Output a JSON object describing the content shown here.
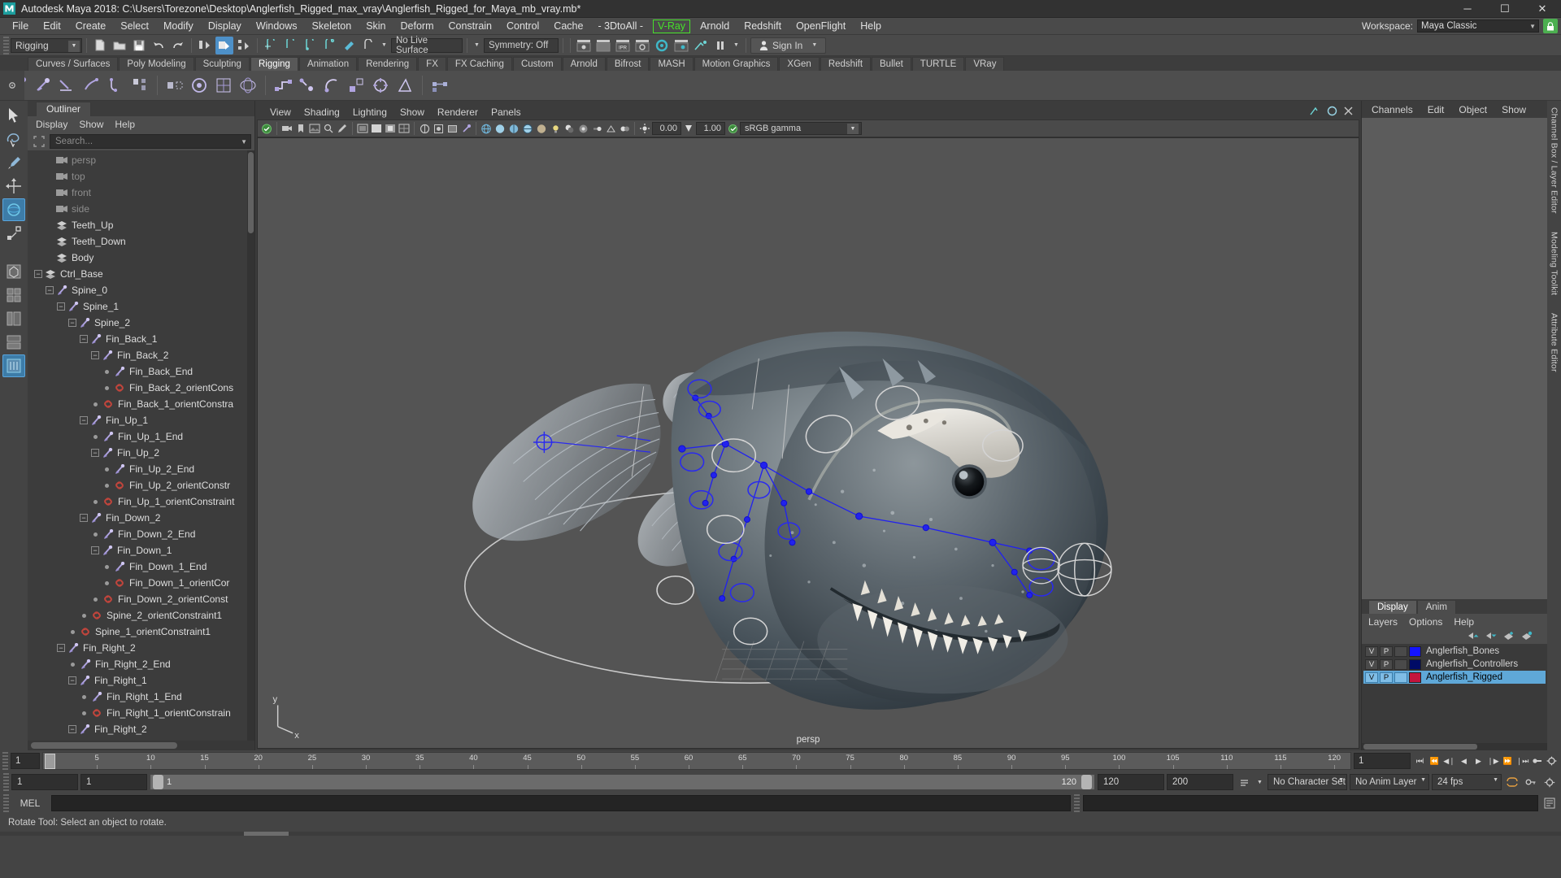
{
  "window": {
    "title": "Autodesk Maya 2018: C:\\Users\\Torezone\\Desktop\\Anglerfish_Rigged_max_vray\\Anglerfish_Rigged_for_Maya_mb_vray.mb*",
    "minimize": "─",
    "maximize": "☐",
    "close": "✕"
  },
  "menubar": {
    "items": [
      "File",
      "Edit",
      "Create",
      "Select",
      "Modify",
      "Display",
      "Windows",
      "Skeleton",
      "Skin",
      "Deform",
      "Constrain",
      "Control",
      "Cache",
      "- 3DtoAll -"
    ],
    "highlighted": "V-Ray",
    "items_after": [
      "Arnold",
      "Redshift",
      "OpenFlight",
      "Help"
    ],
    "workspace_label": "Workspace:",
    "workspace_value": "Maya Classic",
    "lock_icon": "lock-icon"
  },
  "statusbar": {
    "mode": "Rigging",
    "live_surface": "No Live Surface",
    "symmetry": "Symmetry: Off",
    "sign_in": "Sign In"
  },
  "shelf": {
    "tabs": [
      "Curves / Surfaces",
      "Poly Modeling",
      "Sculpting",
      "Rigging",
      "Animation",
      "Rendering",
      "FX",
      "FX Caching",
      "Custom",
      "Arnold",
      "Bifrost",
      "MASH",
      "Motion Graphics",
      "XGen",
      "Redshift",
      "Bullet",
      "TURTLE",
      "VRay"
    ],
    "active_tab": "Rigging"
  },
  "outliner": {
    "tab": "Outliner",
    "menu": [
      "Display",
      "Show",
      "Help"
    ],
    "search_placeholder": "Search...",
    "tree": [
      {
        "label": "persp",
        "depth": 1,
        "icon": "camera-icon",
        "marker": "none",
        "dim": true
      },
      {
        "label": "top",
        "depth": 1,
        "icon": "camera-icon",
        "marker": "none",
        "dim": true
      },
      {
        "label": "front",
        "depth": 1,
        "icon": "camera-icon",
        "marker": "none",
        "dim": true
      },
      {
        "label": "side",
        "depth": 1,
        "icon": "camera-icon",
        "marker": "none",
        "dim": true
      },
      {
        "label": "Teeth_Up",
        "depth": 1,
        "icon": "mesh-icon",
        "marker": "none",
        "dim": false
      },
      {
        "label": "Teeth_Down",
        "depth": 1,
        "icon": "mesh-icon",
        "marker": "none",
        "dim": false
      },
      {
        "label": "Body",
        "depth": 1,
        "icon": "mesh-icon",
        "marker": "none",
        "dim": false
      },
      {
        "label": "Ctrl_Base",
        "depth": 0,
        "icon": "mesh-icon",
        "marker": "expand",
        "dim": false
      },
      {
        "label": "Spine_0",
        "depth": 1,
        "icon": "joint-icon",
        "marker": "expand",
        "dim": false
      },
      {
        "label": "Spine_1",
        "depth": 2,
        "icon": "joint-icon",
        "marker": "expand",
        "dim": false
      },
      {
        "label": "Spine_2",
        "depth": 3,
        "icon": "joint-icon",
        "marker": "expand",
        "dim": false
      },
      {
        "label": "Fin_Back_1",
        "depth": 4,
        "icon": "joint-icon",
        "marker": "expand",
        "dim": false
      },
      {
        "label": "Fin_Back_2",
        "depth": 5,
        "icon": "joint-icon",
        "marker": "expand",
        "dim": false
      },
      {
        "label": "Fin_Back_End",
        "depth": 6,
        "icon": "joint-icon",
        "marker": "dot",
        "dim": false
      },
      {
        "label": "Fin_Back_2_orientCons",
        "depth": 6,
        "icon": "constraint-icon",
        "marker": "dot",
        "dim": false
      },
      {
        "label": "Fin_Back_1_orientConstra",
        "depth": 5,
        "icon": "constraint-icon",
        "marker": "dot",
        "dim": false
      },
      {
        "label": "Fin_Up_1",
        "depth": 4,
        "icon": "joint-icon",
        "marker": "expand",
        "dim": false
      },
      {
        "label": "Fin_Up_1_End",
        "depth": 5,
        "icon": "joint-icon",
        "marker": "dot",
        "dim": false
      },
      {
        "label": "Fin_Up_2",
        "depth": 5,
        "icon": "joint-icon",
        "marker": "expand",
        "dim": false
      },
      {
        "label": "Fin_Up_2_End",
        "depth": 6,
        "icon": "joint-icon",
        "marker": "dot",
        "dim": false
      },
      {
        "label": "Fin_Up_2_orientConstr",
        "depth": 6,
        "icon": "constraint-icon",
        "marker": "dot",
        "dim": false
      },
      {
        "label": "Fin_Up_1_orientConstraint",
        "depth": 5,
        "icon": "constraint-icon",
        "marker": "dot",
        "dim": false
      },
      {
        "label": "Fin_Down_2",
        "depth": 4,
        "icon": "joint-icon",
        "marker": "expand",
        "dim": false
      },
      {
        "label": "Fin_Down_2_End",
        "depth": 5,
        "icon": "joint-icon",
        "marker": "dot",
        "dim": false
      },
      {
        "label": "Fin_Down_1",
        "depth": 5,
        "icon": "joint-icon",
        "marker": "expand",
        "dim": false
      },
      {
        "label": "Fin_Down_1_End",
        "depth": 6,
        "icon": "joint-icon",
        "marker": "dot",
        "dim": false
      },
      {
        "label": "Fin_Down_1_orientCor",
        "depth": 6,
        "icon": "constraint-icon",
        "marker": "dot",
        "dim": false
      },
      {
        "label": "Fin_Down_2_orientConst",
        "depth": 5,
        "icon": "constraint-icon",
        "marker": "dot",
        "dim": false
      },
      {
        "label": "Spine_2_orientConstraint1",
        "depth": 4,
        "icon": "constraint-icon",
        "marker": "dot",
        "dim": false
      },
      {
        "label": "Spine_1_orientConstraint1",
        "depth": 3,
        "icon": "constraint-icon",
        "marker": "dot",
        "dim": false
      },
      {
        "label": "Fin_Right_2",
        "depth": 2,
        "icon": "joint-icon",
        "marker": "expand",
        "dim": false
      },
      {
        "label": "Fin_Right_2_End",
        "depth": 3,
        "icon": "joint-icon",
        "marker": "dot",
        "dim": false
      },
      {
        "label": "Fin_Right_1",
        "depth": 3,
        "icon": "joint-icon",
        "marker": "expand",
        "dim": false
      },
      {
        "label": "Fin_Right_1_End",
        "depth": 4,
        "icon": "joint-icon",
        "marker": "dot",
        "dim": false
      },
      {
        "label": "Fin_Right_1_orientConstrain",
        "depth": 4,
        "icon": "constraint-icon",
        "marker": "dot",
        "dim": false
      },
      {
        "label": "Fin_Right_2",
        "depth": 3,
        "icon": "joint-icon",
        "marker": "expand",
        "dim": false
      }
    ]
  },
  "viewport": {
    "menu": [
      "View",
      "Shading",
      "Lighting",
      "Show",
      "Renderer",
      "Panels"
    ],
    "exposure": "0.00",
    "gain": "1.00",
    "color_space": "sRGB gamma",
    "camera_label": "persp",
    "axis_labels": {
      "y": "y",
      "x": "x"
    }
  },
  "channelbox": {
    "menu": [
      "Channels",
      "Edit",
      "Object",
      "Show"
    ]
  },
  "layers": {
    "tabs": [
      "Display",
      "Anim"
    ],
    "active_tab": "Display",
    "menu": [
      "Layers",
      "Options",
      "Help"
    ],
    "column_v": "V",
    "column_p": "P",
    "rows": [
      {
        "name": "Anglerfish_Bones",
        "color": "#1414ff",
        "visible": "V",
        "playback": "P",
        "selected": false
      },
      {
        "name": "Anglerfish_Controllers",
        "color": "#000b66",
        "visible": "V",
        "playback": "P",
        "selected": false
      },
      {
        "name": "Anglerfish_Rigged",
        "color": "#c4143c",
        "visible": "V",
        "playback": "P",
        "selected": true
      }
    ]
  },
  "side_tabs": [
    "Channel Box / Layer Editor",
    "Modeling Toolkit",
    "Attribute Editor"
  ],
  "timeline": {
    "current_frame": "1",
    "ticks": [
      "5",
      "10",
      "15",
      "20",
      "25",
      "30",
      "35",
      "40",
      "45",
      "50",
      "55",
      "60",
      "65",
      "70",
      "75",
      "80",
      "85",
      "90",
      "95",
      "100",
      "105",
      "110",
      "115",
      "120"
    ],
    "end_field": "1",
    "transport": [
      "go-to-start-icon",
      "step-back-key-icon",
      "step-back-frame-icon",
      "play-backwards-icon",
      "play-forwards-icon",
      "step-forward-frame-icon",
      "step-forward-key-icon",
      "go-to-end-icon"
    ],
    "auto_key_icon": "auto-key-icon",
    "anim_prefs_icon": "animation-preferences-icon"
  },
  "range": {
    "start": "1",
    "playback_start": "1",
    "slider_min": "1",
    "slider_max": "120",
    "playback_end": "120",
    "end": "200",
    "character_set": "No Character Set",
    "anim_layer": "No Anim Layer",
    "fps": "24 fps",
    "loop_icon": "loop-icon",
    "key_icon": "key-icon",
    "prefs_icon": "preferences-icon"
  },
  "command": {
    "language": "MEL",
    "input_value": "",
    "output_value": ""
  },
  "help": {
    "text": "Rotate Tool: Select an object to rotate."
  }
}
